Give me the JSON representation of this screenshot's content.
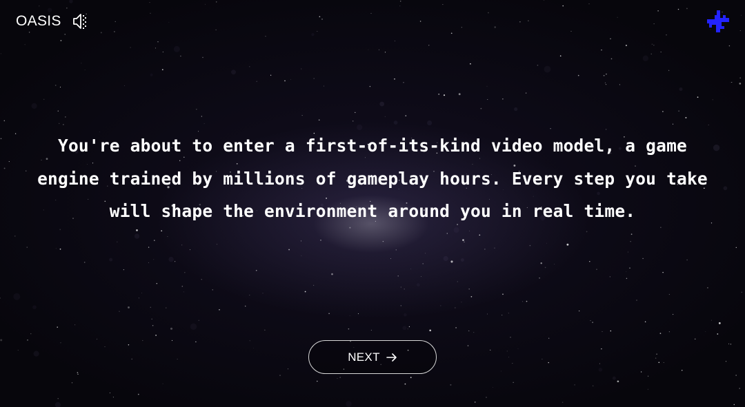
{
  "brand": {
    "name": "OASIS",
    "sound_icon": "speaker-icon",
    "logo_icon": "cross-star-logo-icon",
    "logo_color": "#2323ff"
  },
  "intro": {
    "text": "You're about to enter a first-of-its-kind video model, a game engine trained by millions of gameplay hours. Every step you take will shape the environment around you in real time."
  },
  "next_button": {
    "label": "NEXT",
    "icon": "arrow-right-icon"
  },
  "colors": {
    "background": "#07060c",
    "text": "#ffffff",
    "accent": "#2323ff"
  }
}
